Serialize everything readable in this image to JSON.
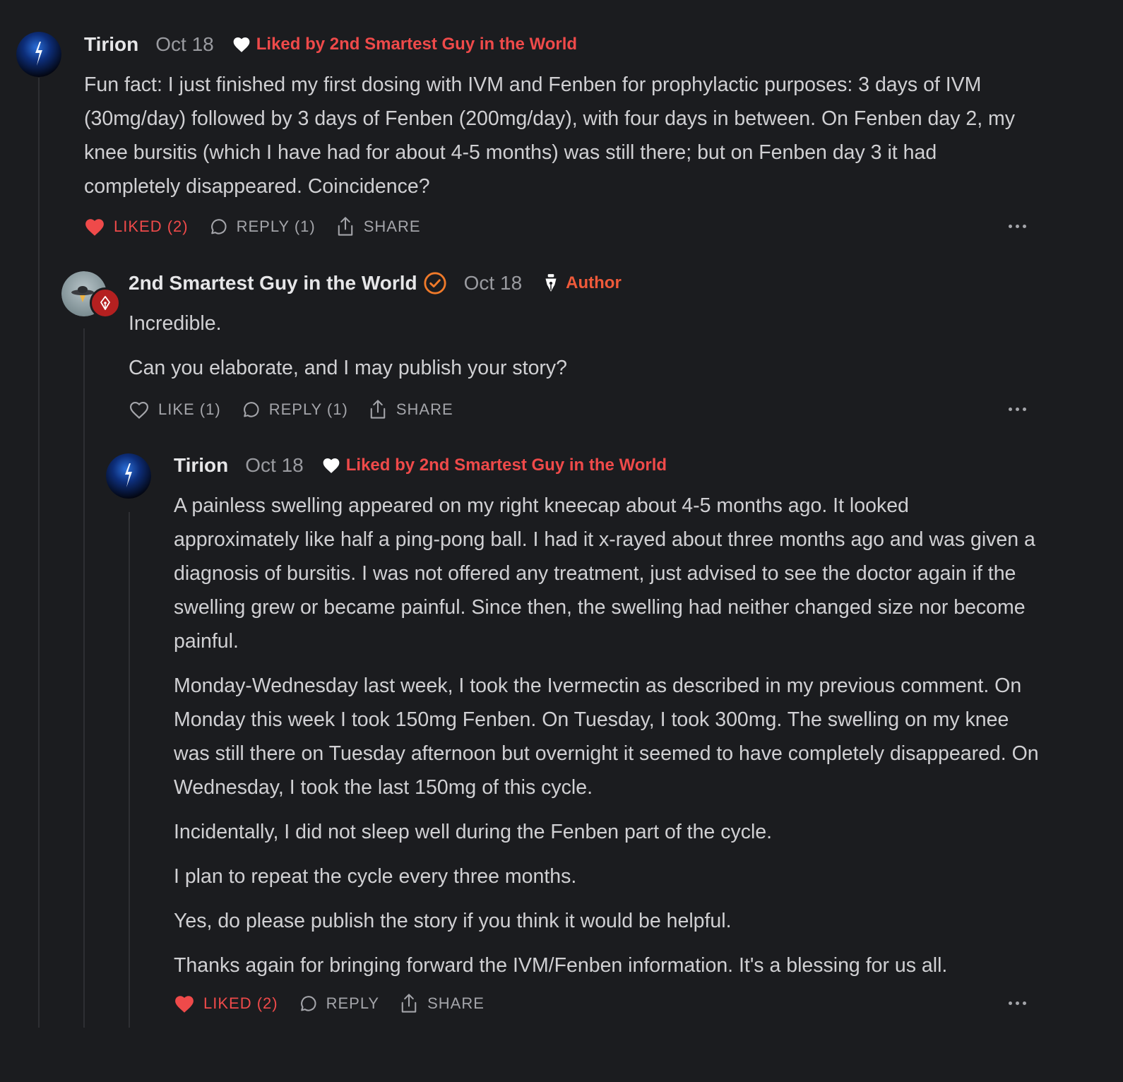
{
  "colors": {
    "background": "#1b1c1f",
    "accent_red": "#ef4a4a",
    "author_orange": "#ef5a3a",
    "muted": "#9a9ba0"
  },
  "comments": [
    {
      "author": "Tirion",
      "date": "Oct 18",
      "liked_by": "Liked by 2nd Smartest Guy in the World",
      "paragraphs": [
        "Fun fact: I just finished my first dosing with IVM and Fenben for prophylactic purposes: 3 days of IVM (30mg/day) followed by 3 days of Fenben (200mg/day), with four days in between. On Fenben day 2, my knee bursitis (which I have had for about 4-5 months) was still there; but on Fenben day 3 it had completely disappeared. Coincidence?"
      ],
      "like_label": "LIKED (2)",
      "reply_label": "REPLY (1)",
      "share_label": "SHARE",
      "liked": true
    },
    {
      "author": "2nd Smartest Guy in the World",
      "date": "Oct 18",
      "author_tag": "Author",
      "verified": true,
      "paragraphs": [
        "Incredible.",
        "Can you elaborate, and I may publish your story?"
      ],
      "like_label": "LIKE (1)",
      "reply_label": "REPLY (1)",
      "share_label": "SHARE",
      "liked": false
    },
    {
      "author": "Tirion",
      "date": "Oct 18",
      "liked_by": "Liked by 2nd Smartest Guy in the World",
      "paragraphs": [
        "A painless swelling appeared on my right kneecap about 4-5 months ago. It looked approximately like half a ping-pong ball. I had it x-rayed about three months ago and was given a diagnosis of bursitis. I was not offered any treatment, just advised to see the doctor again if the swelling grew or became painful. Since then, the swelling had neither changed size nor become painful.",
        "Monday-Wednesday last week, I took the Ivermectin as described in my previous comment. On Monday this week I took 150mg Fenben. On Tuesday, I took 300mg. The swelling on my knee was still there on Tuesday afternoon but overnight it seemed to have completely disappeared. On Wednesday, I took the last 150mg of this cycle.",
        "Incidentally, I did not sleep well during the Fenben part of the cycle.",
        "I plan to repeat the cycle every three months.",
        "Yes, do please publish the story if you think it would be helpful.",
        "Thanks again for bringing forward the IVM/Fenben information. It's a blessing for us all."
      ],
      "like_label": "LIKED (2)",
      "reply_label": "REPLY",
      "share_label": "SHARE",
      "liked": true
    }
  ]
}
